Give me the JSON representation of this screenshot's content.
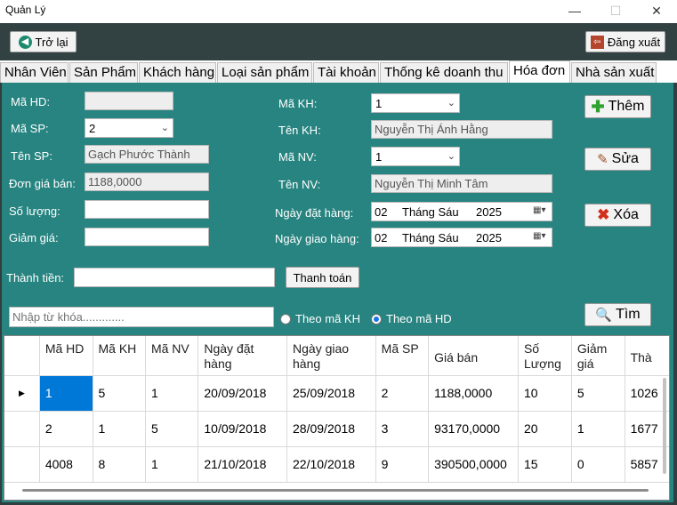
{
  "window": {
    "title": "Quản Lý",
    "minimize": "—",
    "maximize": "☐",
    "close": "✕"
  },
  "toolbar": {
    "back_label": "Trở lại",
    "logout_label": "Đăng xuất"
  },
  "tabs": [
    "Nhân Viên",
    "Sản Phẩm",
    "Khách hàng",
    "Loại sản phẩm",
    "Tài khoản",
    "Thống kê doanh thu",
    "Hóa đơn",
    "Nhà sản xuất"
  ],
  "active_tab": "Hóa đơn",
  "form": {
    "ma_hd_label": "Mã HD:",
    "ma_hd_value": "",
    "ma_sp_label": "Mã SP:",
    "ma_sp_value": "2",
    "ten_sp_label": "Tên SP:",
    "ten_sp_value": "Gạch Phước Thành",
    "don_gia_label": "Đơn giá bán:",
    "don_gia_value": "1188,0000",
    "so_luong_label": "Số lượng:",
    "so_luong_value": "",
    "giam_gia_label": "Giảm giá:",
    "giam_gia_value": "",
    "ma_kh_label": "Mã KH:",
    "ma_kh_value": "1",
    "ten_kh_label": "Tên KH:",
    "ten_kh_value": "Nguyễn Thị Ánh Hằng",
    "ma_nv_label": "Mã NV:",
    "ma_nv_value": "1",
    "ten_nv_label": "Tên NV:",
    "ten_nv_value": "Nguyễn Thị Minh Tâm",
    "ngay_dat_label": "Ngày đặt hàng:",
    "ngay_dat": {
      "day": "02",
      "month": "Tháng Sáu",
      "year": "2025"
    },
    "ngay_giao_label": "Ngày giao hàng:",
    "ngay_giao": {
      "day": "02",
      "month": "Tháng Sáu",
      "year": "2025"
    },
    "thanh_tien_label": "Thành tiền:",
    "thanh_tien_value": "",
    "thanh_toan_label": "Thanh toán"
  },
  "actions": {
    "them": "Thêm",
    "sua": "Sửa",
    "xoa": "Xóa",
    "tim": "Tìm"
  },
  "search": {
    "placeholder": "Nhập từ khóa.............",
    "radio_kh": "Theo mã KH",
    "radio_hd": "Theo mã HD",
    "selected": "Theo mã HD"
  },
  "table": {
    "columns": [
      "Mã HD",
      "Mã KH",
      "Mã NV",
      "Ngày đặt hàng",
      "Ngày giao hàng",
      "Mã SP",
      "Giá bán",
      "Số Lượng",
      "Giảm giá",
      "Thà"
    ],
    "rows": [
      [
        "1",
        "5",
        "1",
        "20/09/2018",
        "25/09/2018",
        "2",
        "1188,0000",
        "10",
        "5",
        "1026"
      ],
      [
        "2",
        "1",
        "5",
        "10/09/2018",
        "28/09/2018",
        "3",
        "93170,0000",
        "20",
        "1",
        "1677"
      ],
      [
        "4008",
        "8",
        "1",
        "21/10/2018",
        "22/10/2018",
        "9",
        "390500,0000",
        "15",
        "0",
        "5857"
      ]
    ]
  },
  "colors": {
    "panel": "#278480",
    "selected_cell": "#0078d7"
  }
}
